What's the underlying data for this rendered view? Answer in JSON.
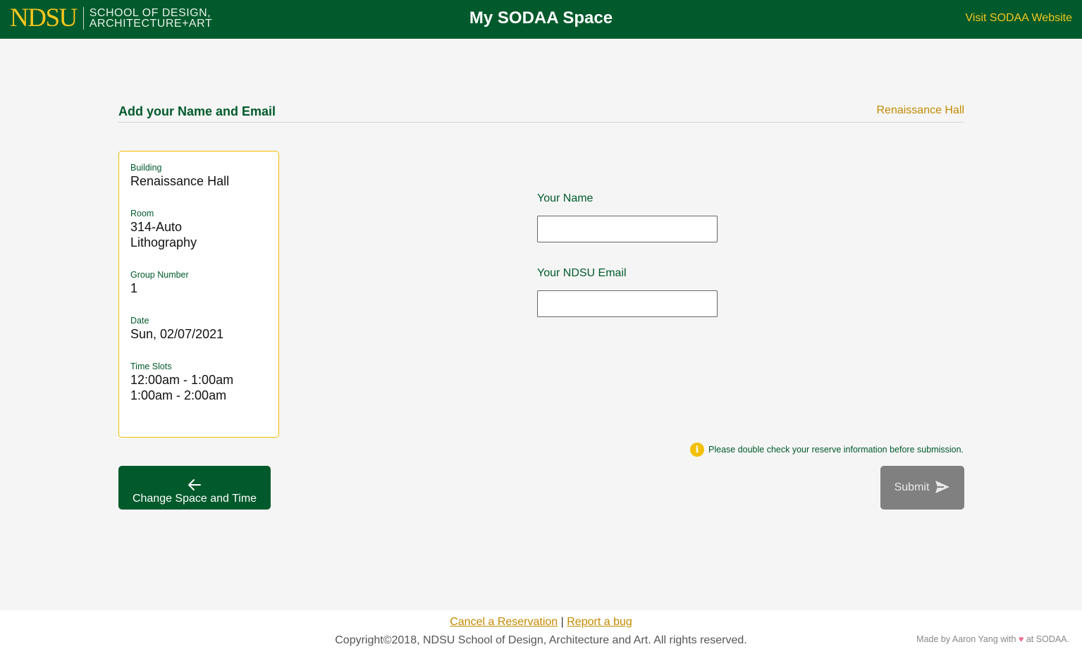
{
  "header": {
    "logo_ndsu": "NDSU",
    "logo_line1": "SCHOOL OF DESIGN,",
    "logo_line2": "ARCHITECTURE+ART",
    "title": "My SODAA Space",
    "visit_link": "Visit SODAA Website"
  },
  "section": {
    "title": "Add your Name and Email",
    "building": "Renaissance Hall"
  },
  "summary": {
    "building_label": "Building",
    "building_value": "Renaissance Hall",
    "room_label": "Room",
    "room_line1": "314-Auto",
    "room_line2": "Lithography",
    "group_label": "Group Number",
    "group_value": "1",
    "date_label": "Date",
    "date_value": "Sun, 02/07/2021",
    "timeslots_label": "Time Slots",
    "timeslots": [
      "12:00am - 1:00am",
      "1:00am - 2:00am"
    ]
  },
  "form": {
    "name_label": "Your Name",
    "name_value": "",
    "email_label": "Your NDSU Email",
    "email_value": ""
  },
  "notice": {
    "icon": "info-icon",
    "icon_glyph": "i",
    "text": "Please double check your reserve information before submission."
  },
  "buttons": {
    "change_arrow": "🡐",
    "change_label": "Change Space and Time",
    "submit_label": "Submit",
    "submit_icon": "send-icon"
  },
  "footer": {
    "cancel_link": "Cancel a Reservation",
    "separator": "|",
    "bug_link": "Report a bug",
    "copyright": "Copyright©2018, NDSU School of Design, Architecture and Art. All rights reserved.",
    "credit_pre": "Made by Aaron Yang with",
    "credit_heart": "♥",
    "credit_post": "at SODAA."
  },
  "colors": {
    "brand_green": "#005a2b",
    "brand_gold": "#f7c51d",
    "accent_gold": "#c28a00",
    "disabled_gray": "#808080"
  }
}
